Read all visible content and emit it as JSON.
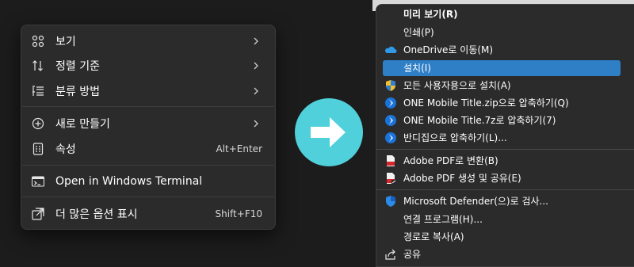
{
  "background_fragment": "...",
  "win11_menu": {
    "items": [
      {
        "label": "보기",
        "icon": "grid-icon",
        "submenu": true
      },
      {
        "label": "정렬 기준",
        "icon": "sort-icon",
        "submenu": true
      },
      {
        "label": "분류 방법",
        "icon": "group-by-icon",
        "submenu": true
      },
      {
        "label": "새로 만들기",
        "icon": "new-plus-icon",
        "submenu": true
      },
      {
        "label": "속성",
        "icon": "properties-icon",
        "shortcut": "Alt+Enter"
      },
      {
        "label": "Open in Windows Terminal",
        "icon": "terminal-icon"
      },
      {
        "label": "더 많은 옵션 표시",
        "icon": "show-more-icon",
        "shortcut": "Shift+F10"
      }
    ]
  },
  "arrow_color": "#4fd0da",
  "classic_menu": {
    "highlight_color": "#2f7fc7",
    "items": [
      {
        "label": "미리 보기(R)",
        "bold": true
      },
      {
        "label": "인쇄(P)"
      },
      {
        "label": "OneDrive로 이동(M)",
        "icon": "onedrive-cloud-icon"
      },
      {
        "label": "설치(I)",
        "highlighted": true
      },
      {
        "label": "모든 사용자용으로 설치(A)",
        "icon": "uac-shield-icon"
      },
      {
        "label": "ONE Mobile Title.zip으로 압축하기(Q)",
        "icon": "bandizip-icon"
      },
      {
        "label": "ONE Mobile Title.7z로 압축하기(7)",
        "icon": "bandizip-icon"
      },
      {
        "label": "반디집으로 압축하기(L)...",
        "icon": "bandizip-icon"
      },
      {
        "label": "Adobe PDF로 변환(B)",
        "icon": "adobe-pdf-icon"
      },
      {
        "label": "Adobe PDF 생성 및 공유(E)",
        "icon": "adobe-pdf-share-icon"
      },
      {
        "label": "Microsoft Defender(으)로 검사...",
        "icon": "defender-shield-icon"
      },
      {
        "label": "연결 프로그램(H)..."
      },
      {
        "label": "경로로 복사(A)"
      },
      {
        "label": "공유",
        "icon": "share-icon"
      }
    ]
  }
}
